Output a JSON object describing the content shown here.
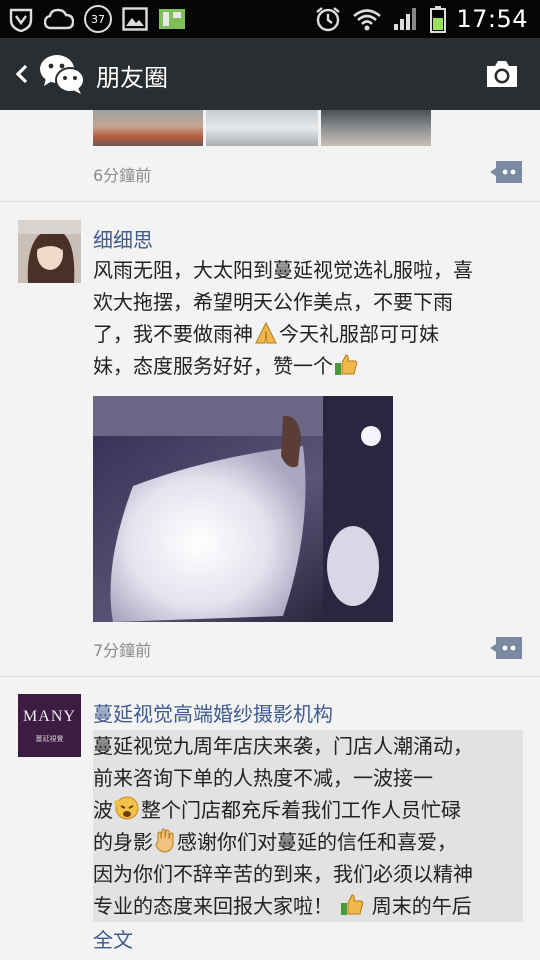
{
  "status_bar": {
    "time": "17:54",
    "notification_badge": "37"
  },
  "title_bar": {
    "title": "朋友圈"
  },
  "posts": [
    {
      "time": "6分鐘前"
    },
    {
      "author": "细细思",
      "lines": [
        "风雨无阻，大太阳到蔓延视觉选礼服啦，喜",
        "欢大拖摆，希望明天公作美点，不要下雨",
        "了，我不要做雨神",
        "今天礼服部可可妹",
        "妹，态度服务好好，赞一个"
      ],
      "time": "7分鐘前"
    },
    {
      "author": "蔓延视觉高端婚纱摄影机构",
      "avatar_logo_text": "MANY",
      "avatar_logo_sub": "蔓延視覺",
      "lines": [
        "蔓延视觉九周年店庆来袭，门店人潮涌动，",
        "前来咨询下单的人热度不减，一波接一",
        "波",
        "整个门店都充斥着我们工作人员忙碌",
        "的身影",
        "感谢你们对蔓延的信任和喜爱，",
        "因为你们不辞辛苦的到来，我们必须以精神",
        "专业的态度来回报大家啦！",
        "周末的午后"
      ],
      "full_text_label": "全文"
    }
  ],
  "colors": {
    "title_bar_bg": "#2a2e31",
    "link_blue": "#3f5b8f",
    "page_bg": "#f3f3f3"
  },
  "icons": [
    "back-chevron-icon",
    "wechat-logo-icon",
    "camera-icon",
    "comment-icon",
    "wifi-icon",
    "signal-icon",
    "battery-icon",
    "alarm-icon"
  ]
}
